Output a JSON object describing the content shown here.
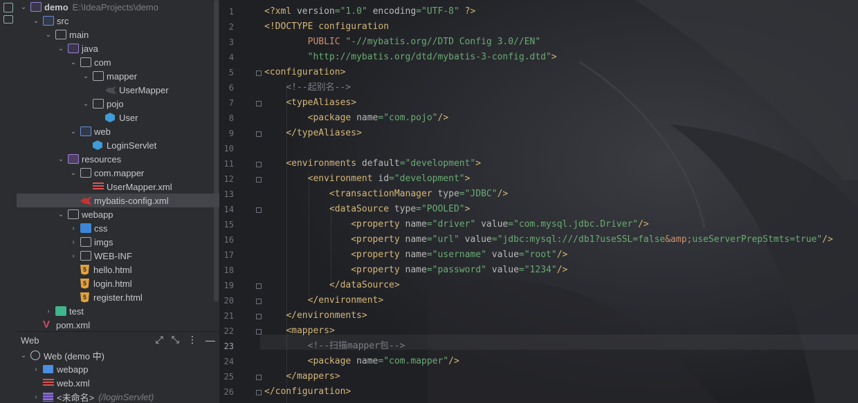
{
  "project_tree": [
    {
      "label": "demo",
      "path": "E:\\IdeaProjects\\demo",
      "depth": 0,
      "expanded": true,
      "icon": "module-folder-icon"
    },
    {
      "label": "src",
      "depth": 1,
      "expanded": true,
      "icon": "source-folder-icon"
    },
    {
      "label": "main",
      "depth": 2,
      "expanded": true,
      "icon": "folder-icon"
    },
    {
      "label": "java",
      "depth": 3,
      "expanded": true,
      "icon": "java-source-folder-icon"
    },
    {
      "label": "com",
      "depth": 4,
      "expanded": true,
      "icon": "package-icon"
    },
    {
      "label": "mapper",
      "depth": 5,
      "expanded": true,
      "icon": "package-icon"
    },
    {
      "label": "UserMapper",
      "depth": 6,
      "icon": "mybatis-mapper-icon"
    },
    {
      "label": "pojo",
      "depth": 5,
      "expanded": true,
      "icon": "package-icon"
    },
    {
      "label": "User",
      "depth": 6,
      "icon": "class-icon"
    },
    {
      "label": "web",
      "depth": 4,
      "expanded": true,
      "icon": "web-package-icon"
    },
    {
      "label": "LoginServlet",
      "depth": 5,
      "icon": "class-icon"
    },
    {
      "label": "resources",
      "depth": 3,
      "expanded": true,
      "icon": "resources-folder-icon"
    },
    {
      "label": "com.mapper",
      "depth": 4,
      "expanded": true,
      "icon": "package-icon"
    },
    {
      "label": "UserMapper.xml",
      "depth": 5,
      "icon": "xml-file-icon"
    },
    {
      "label": "mybatis-config.xml",
      "depth": 4,
      "icon": "mybatis-config-icon",
      "selected": true
    },
    {
      "label": "webapp",
      "depth": 3,
      "expanded": true,
      "icon": "folder-icon"
    },
    {
      "label": "css",
      "depth": 4,
      "collapsed": true,
      "icon": "css-folder-icon"
    },
    {
      "label": "imgs",
      "depth": 4,
      "collapsed": true,
      "icon": "folder-icon"
    },
    {
      "label": "WEB-INF",
      "depth": 4,
      "collapsed": true,
      "icon": "folder-icon"
    },
    {
      "label": "hello.html",
      "depth": 4,
      "icon": "html-file-icon"
    },
    {
      "label": "login.html",
      "depth": 4,
      "icon": "html-file-icon"
    },
    {
      "label": "register.html",
      "depth": 4,
      "icon": "html-file-icon"
    },
    {
      "label": "test",
      "depth": 2,
      "collapsed": true,
      "icon": "test-folder-icon"
    },
    {
      "label": "pom.xml",
      "depth": 1,
      "icon": "maven-icon"
    }
  ],
  "web_panel": {
    "title": "Web",
    "items": [
      {
        "label": "Web (demo 中)",
        "depth": 0,
        "expanded": true,
        "icon": "globe-icon"
      },
      {
        "label": "webapp",
        "depth": 1,
        "collapsed": true,
        "icon": "image-folder-icon"
      },
      {
        "label": "web.xml",
        "depth": 1,
        "icon": "xml-file-icon"
      },
      {
        "label": "<未命名>",
        "hint": "(/loginServlet)",
        "depth": 1,
        "collapsed": true,
        "icon": "servlet-icon"
      }
    ]
  },
  "editor": {
    "current_line": 23,
    "lines": [
      "<?xml version=\"1.0\" encoding=\"UTF-8\" ?>",
      "<!DOCTYPE configuration",
      "        PUBLIC \"-//mybatis.org//DTD Config 3.0//EN\"",
      "        \"http://mybatis.org/dtd/mybatis-3-config.dtd\">",
      "<configuration>",
      "    <!--起别名-->",
      "    <typeAliases>",
      "        <package name=\"com.pojo\"/>",
      "    </typeAliases>",
      "",
      "    <environments default=\"development\">",
      "        <environment id=\"development\">",
      "            <transactionManager type=\"JDBC\"/>",
      "            <dataSource type=\"POOLED\">",
      "                <property name=\"driver\" value=\"com.mysql.jdbc.Driver\"/>",
      "                <property name=\"url\" value=\"jdbc:mysql:///db1?useSSL=false&amp;useServerPrepStmts=true\"/>",
      "                <property name=\"username\" value=\"root\"/>",
      "                <property name=\"password\" value=\"1234\"/>",
      "            </dataSource>",
      "        </environment>",
      "    </environments>",
      "    <mappers>",
      "        <!--扫描mapper包-->",
      "        <package name=\"com.mapper\"/>",
      "    </mappers>",
      "</configuration>"
    ]
  },
  "colors": {
    "panel_bg": "#2b2d30",
    "editor_bg": "#1f1f21",
    "selection": "#43454a",
    "tag": "#d5b778",
    "string": "#6aab73",
    "comment": "#7a7e85"
  }
}
